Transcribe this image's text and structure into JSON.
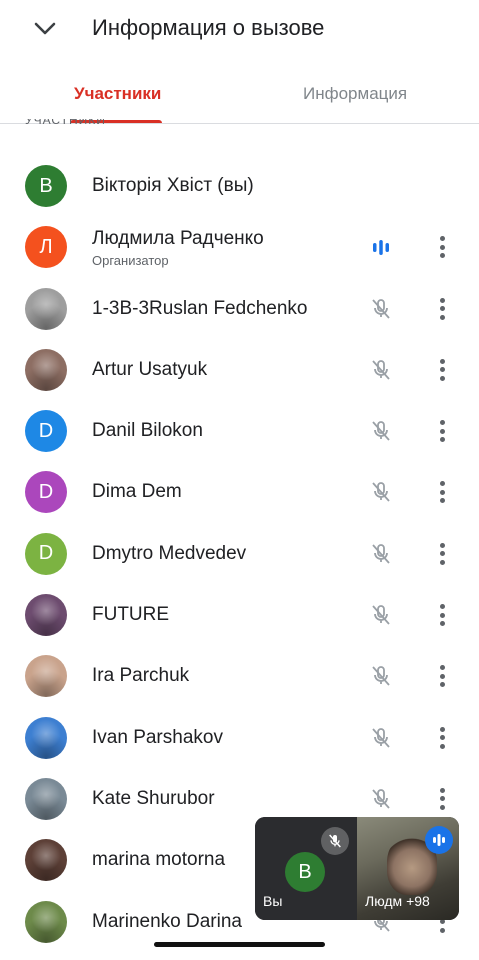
{
  "header": {
    "title": "Информация о вызове"
  },
  "tabs": [
    {
      "label": "Участники",
      "active": true
    },
    {
      "label": "Информация",
      "active": false
    }
  ],
  "section_label": "УЧАСТНИКИ",
  "participants": [
    {
      "name": "Вікторія Хвіст (вы)",
      "initial": "В",
      "color": "#2e7d32",
      "mic": "none"
    },
    {
      "name": "Людмила Радченко",
      "subtitle": "Организатор",
      "initial": "Л",
      "color": "#f4511e",
      "mic": "speaking"
    },
    {
      "name": "1-3В-3Ruslan Fedchenko",
      "initial": "",
      "color": "#9e9e9e",
      "mic": "muted",
      "photo": "photo-ruslan"
    },
    {
      "name": "Artur Usatyuk",
      "initial": "",
      "color": "#8d6e63",
      "mic": "muted",
      "photo": "photo-artur"
    },
    {
      "name": "Danil Bilokon",
      "initial": "D",
      "color": "#1e88e5",
      "mic": "muted"
    },
    {
      "name": "Dima Dem",
      "initial": "D",
      "color": "#ab47bc",
      "mic": "muted"
    },
    {
      "name": "Dmytro Medvedev",
      "initial": "D",
      "color": "#7cb342",
      "mic": "muted"
    },
    {
      "name": "FUTURE",
      "initial": "",
      "color": "#6d4c6f",
      "mic": "muted",
      "photo": "photo-future"
    },
    {
      "name": "Ira Parchuk",
      "initial": "",
      "color": "#c9a38c",
      "mic": "muted",
      "photo": "photo-ira"
    },
    {
      "name": "Ivan Parshakov",
      "initial": "",
      "color": "#3d7fd1",
      "mic": "muted",
      "photo": "photo-ivan"
    },
    {
      "name": "Kate Shurubor",
      "initial": "",
      "color": "#7a8a96",
      "mic": "muted",
      "photo": "photo-kate"
    },
    {
      "name": "marina motorna",
      "initial": "",
      "color": "#5d4037",
      "mic": "muted",
      "photo": "photo-marina"
    },
    {
      "name": "Marinenko Darina",
      "initial": "",
      "color": "#6d8a4a",
      "mic": "muted",
      "photo": "photo-darina"
    }
  ],
  "pip": {
    "self_initial": "В",
    "self_label": "Вы",
    "other_label": "Людм",
    "extra_count": "+98"
  },
  "colors": {
    "accent": "#d93025",
    "speaking": "#1a73e8"
  }
}
